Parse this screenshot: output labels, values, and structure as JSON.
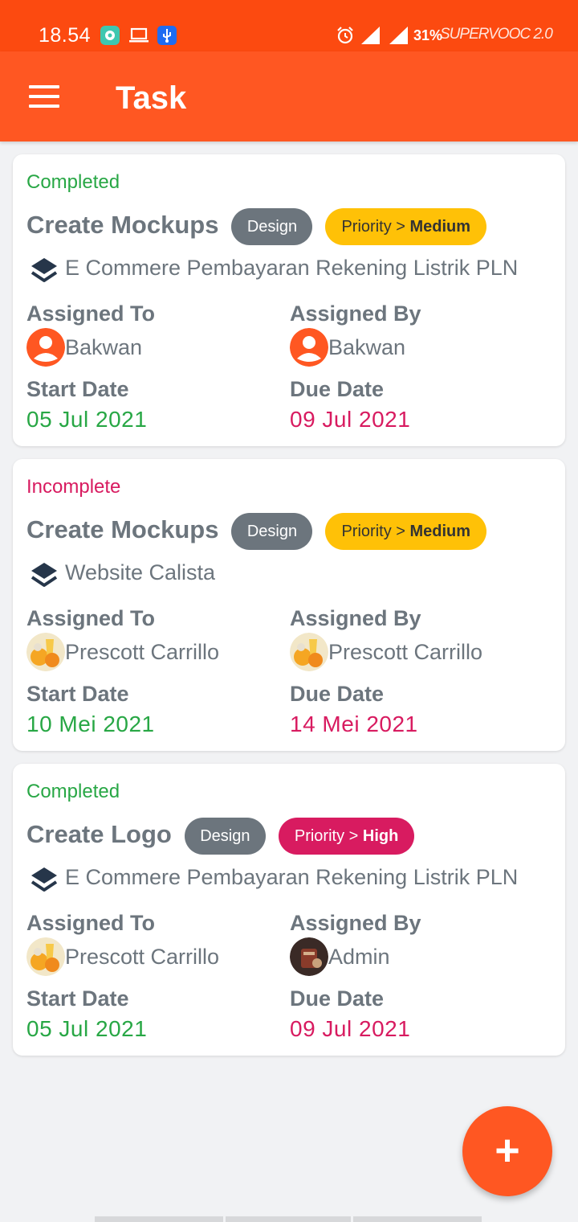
{
  "status_bar": {
    "time": "18.54",
    "battery": "31%",
    "charging_brand": "SUPERVOOC 2.0",
    "icons": [
      "messenger-icon",
      "laptop-icon",
      "usb-icon",
      "alarm-icon",
      "signal-icon",
      "signal-icon"
    ]
  },
  "app_bar": {
    "title": "Task",
    "menu_icon": "hamburger-menu-icon"
  },
  "labels": {
    "assigned_to": "Assigned To",
    "assigned_by": "Assigned By",
    "start_date": "Start Date",
    "due_date": "Due Date",
    "priority_prefix": "Priority > "
  },
  "tasks": [
    {
      "status": "Completed",
      "title": "Create Mockups",
      "category": "Design",
      "priority": "Medium",
      "project": "E Commere Pembayaran Rekening Listrik PLN",
      "assigned_to": "Bakwan",
      "assigned_by": "Bakwan",
      "start_date": "05 Jul 2021",
      "due_date": "09 Jul 2021"
    },
    {
      "status": "Incomplete",
      "title": "Create Mockups",
      "category": "Design",
      "priority": "Medium",
      "project": "Website Calista",
      "assigned_to": "Prescott Carrillo",
      "assigned_by": "Prescott Carrillo",
      "start_date": "10 Mei 2021",
      "due_date": "14 Mei 2021"
    },
    {
      "status": "Completed",
      "title": "Create Logo",
      "category": "Design",
      "priority": "High",
      "project": "E Commere Pembayaran Rekening Listrik PLN",
      "assigned_to": "Prescott Carrillo",
      "assigned_by": "Admin",
      "start_date": "05 Jul 2021",
      "due_date": "09 Jul 2021"
    }
  ],
  "fab": {
    "label": "+"
  },
  "colors": {
    "status_bar": "#fc4a10",
    "app_bar": "#ff5722",
    "completed": "#28a745",
    "incomplete": "#d81b60",
    "category_badge": "#6c757d",
    "priority_medium": "#ffc107",
    "priority_high": "#d81b60"
  }
}
